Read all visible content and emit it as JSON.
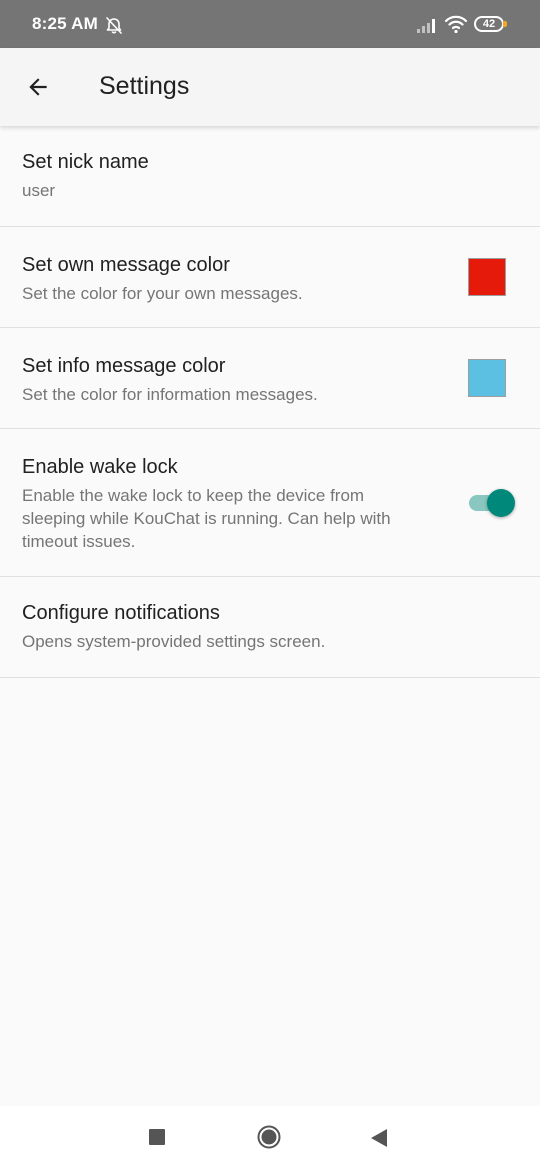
{
  "status_bar": {
    "time": "8:25 AM",
    "battery": "42",
    "icons": [
      "alarm-off-icon",
      "signal-icon",
      "wifi-icon",
      "battery-icon"
    ]
  },
  "app_bar": {
    "title": "Settings",
    "back_icon": "arrow-back-icon"
  },
  "preferences": [
    {
      "title": "Set nick name",
      "summary": "user"
    },
    {
      "title": "Set own message color",
      "summary": "Set the color for your own messages.",
      "color": "#e51a0a"
    },
    {
      "title": "Set info message color",
      "summary": "Set the color for information messages.",
      "color": "#5bc0e1"
    },
    {
      "title": "Enable wake lock",
      "summary": "Enable the wake lock to keep the device from sleeping while KouChat is running. Can help with timeout issues.",
      "enabled": true
    },
    {
      "title": "Configure notifications",
      "summary": "Opens system-provided settings screen."
    }
  ],
  "colors": {
    "accent": "#00897b",
    "status_bar": "#757575",
    "battery_indicator": "#f5a623"
  },
  "nav_bar": {
    "icons": [
      "recents-icon",
      "home-icon",
      "back-triangle-icon"
    ]
  }
}
